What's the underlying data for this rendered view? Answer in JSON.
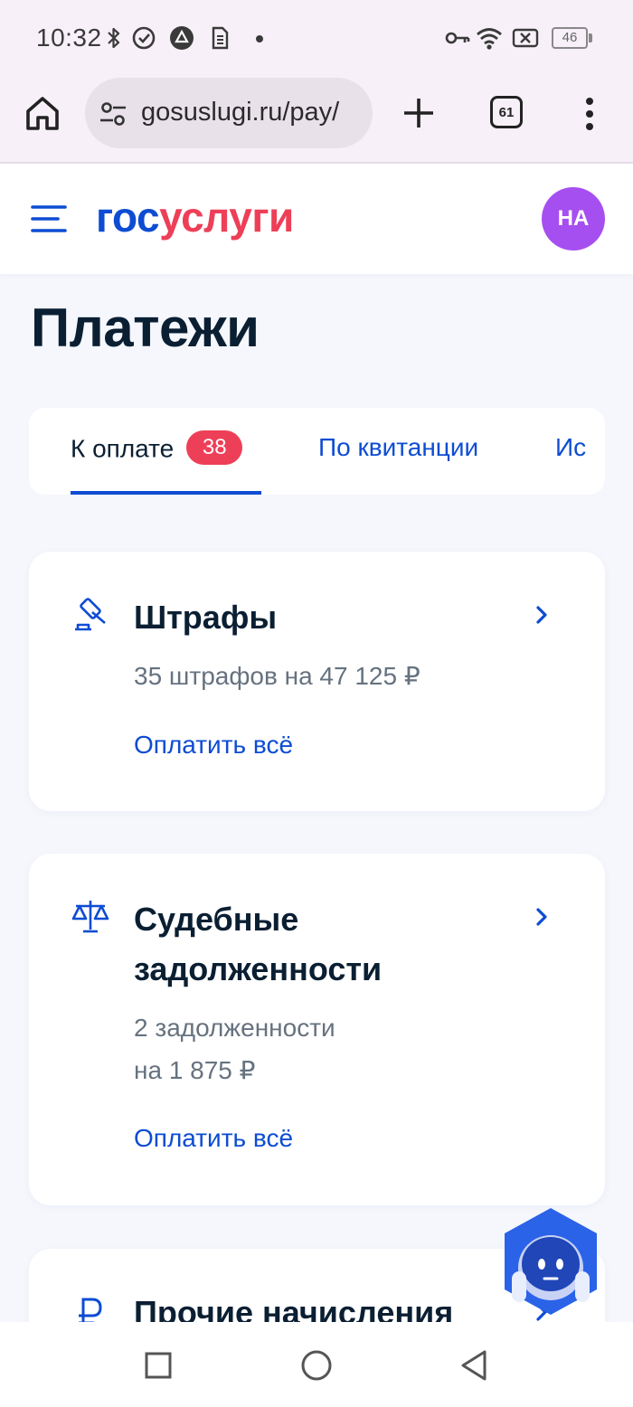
{
  "status_bar": {
    "time": "10:32",
    "battery": "46"
  },
  "browser": {
    "url": "gosuslugi.ru/pay/",
    "tab_count": "61"
  },
  "site": {
    "logo_part1": "гос",
    "logo_part2": "услуги",
    "avatar_initials": "НА"
  },
  "page": {
    "title": "Платежи"
  },
  "tabs": [
    {
      "label": "К оплате",
      "badge": "38",
      "active": true
    },
    {
      "label": "По квитанции",
      "active": false
    },
    {
      "label": "Ис",
      "active": false
    }
  ],
  "cards": [
    {
      "title": "Штрафы",
      "subtitle": "35 штрафов на 47 125 ₽",
      "action": "Оплатить всё",
      "icon": "gavel-icon"
    },
    {
      "title_line1": "Судебные",
      "title_line2": "задолженности",
      "subtitle_line1": "2 задолженности",
      "subtitle_line2": "на 1 875 ₽",
      "action": "Оплатить всё",
      "icon": "scales-icon"
    },
    {
      "title": "Прочие начисления",
      "icon": "ruble-icon"
    }
  ],
  "colors": {
    "brand_blue": "#0d4cd3",
    "brand_red": "#ee3f58",
    "avatar": "#a64ff0",
    "text_dark": "#0b1f33",
    "text_muted": "#66727f"
  }
}
